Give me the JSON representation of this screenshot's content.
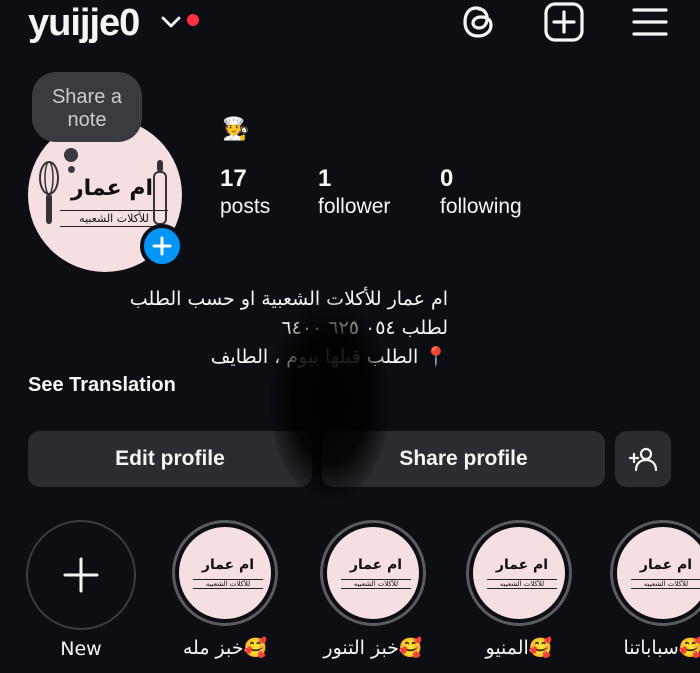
{
  "header": {
    "username": "yuijje0",
    "has_unread_dot": true
  },
  "note": {
    "placeholder": "Share a note"
  },
  "profile": {
    "logo_title": "ام عمار",
    "logo_subtitle": "للأكلات الشعبيه",
    "emoji": "🧑‍🍳"
  },
  "stats": [
    {
      "value": "17",
      "label": "posts"
    },
    {
      "value": "1",
      "label": "follower"
    },
    {
      "value": "0",
      "label": "following"
    }
  ],
  "bio": {
    "line1": "ام عمار للأكلات الشعبية او حسب الطلب",
    "line2": "لطلب ٠٥٤ ٦٢٥ ٦٤٠٠",
    "line3": "📍 الطلب قبلها بيوم ، الطايف",
    "see_translation": "See Translation"
  },
  "buttons": {
    "edit": "Edit profile",
    "share": "Share profile"
  },
  "highlights": [
    {
      "label": "New"
    },
    {
      "label": "🥰خبز مله"
    },
    {
      "label": "🥰خبز التنور"
    },
    {
      "label": "🥰المنيو"
    },
    {
      "label": "🥰سباباتنا"
    }
  ],
  "colors": {
    "background": "#0c0e14",
    "accent_blue": "#0095f6",
    "button_bg": "#2a2c31",
    "notification_dot": "#ff3040",
    "logo_bg": "#f6dfe0"
  }
}
